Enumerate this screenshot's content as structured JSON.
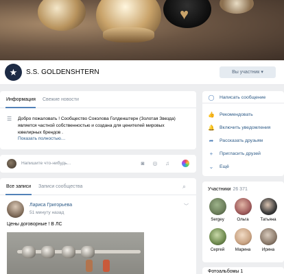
{
  "group": {
    "name": "S.S. GOLDENSHTERN",
    "member_button": "Вы участник",
    "member_button_arrow": "▾"
  },
  "info_tabs": [
    "Информация",
    "Свежие новости"
  ],
  "info": {
    "text": "Добро пожаловать ! Сообщество Соколова Голденштерн (Золотая Звезда) является частной собственностью и создана для ценителей мировых ювелирных брендов .",
    "more": "Показать полностью…"
  },
  "compose": {
    "placeholder": "Напишите что-нибудь..."
  },
  "wall_tabs": [
    "Все записи",
    "Записи сообщества"
  ],
  "post": {
    "author": "Лариса Григорьева",
    "time": "51 минуту назад",
    "text": "Цены договорные ! В ЛС"
  },
  "actions": [
    {
      "label": "Написать сообщение",
      "icon": "message-icon"
    },
    {
      "label": "Рекомендовать",
      "icon": "thumbs-up-icon"
    },
    {
      "label": "Включить уведомления",
      "icon": "bell-icon"
    },
    {
      "label": "Рассказать друзьям",
      "icon": "share-icon"
    },
    {
      "label": "Пригласить друзей",
      "icon": "add-user-icon"
    },
    {
      "label": "Ещё",
      "icon": "chevron-down-icon"
    }
  ],
  "members": {
    "title": "Участники",
    "count": "26 371",
    "list": [
      {
        "name": "Sergey",
        "color": "#6b7d5a"
      },
      {
        "name": "Ольга",
        "color": "#a05c5c"
      },
      {
        "name": "Татьяна",
        "color": "#3a3a3a"
      },
      {
        "name": "Сергей",
        "color": "#6f8a4f"
      },
      {
        "name": "Марина",
        "color": "#c9a383"
      },
      {
        "name": "Ирина",
        "color": "#8b7a6b"
      }
    ]
  },
  "photos": {
    "title": "Фотоальбомы 1"
  },
  "colors": {
    "link": "#2a5885",
    "accent": "#5181b8",
    "bg": "#edeef0"
  }
}
